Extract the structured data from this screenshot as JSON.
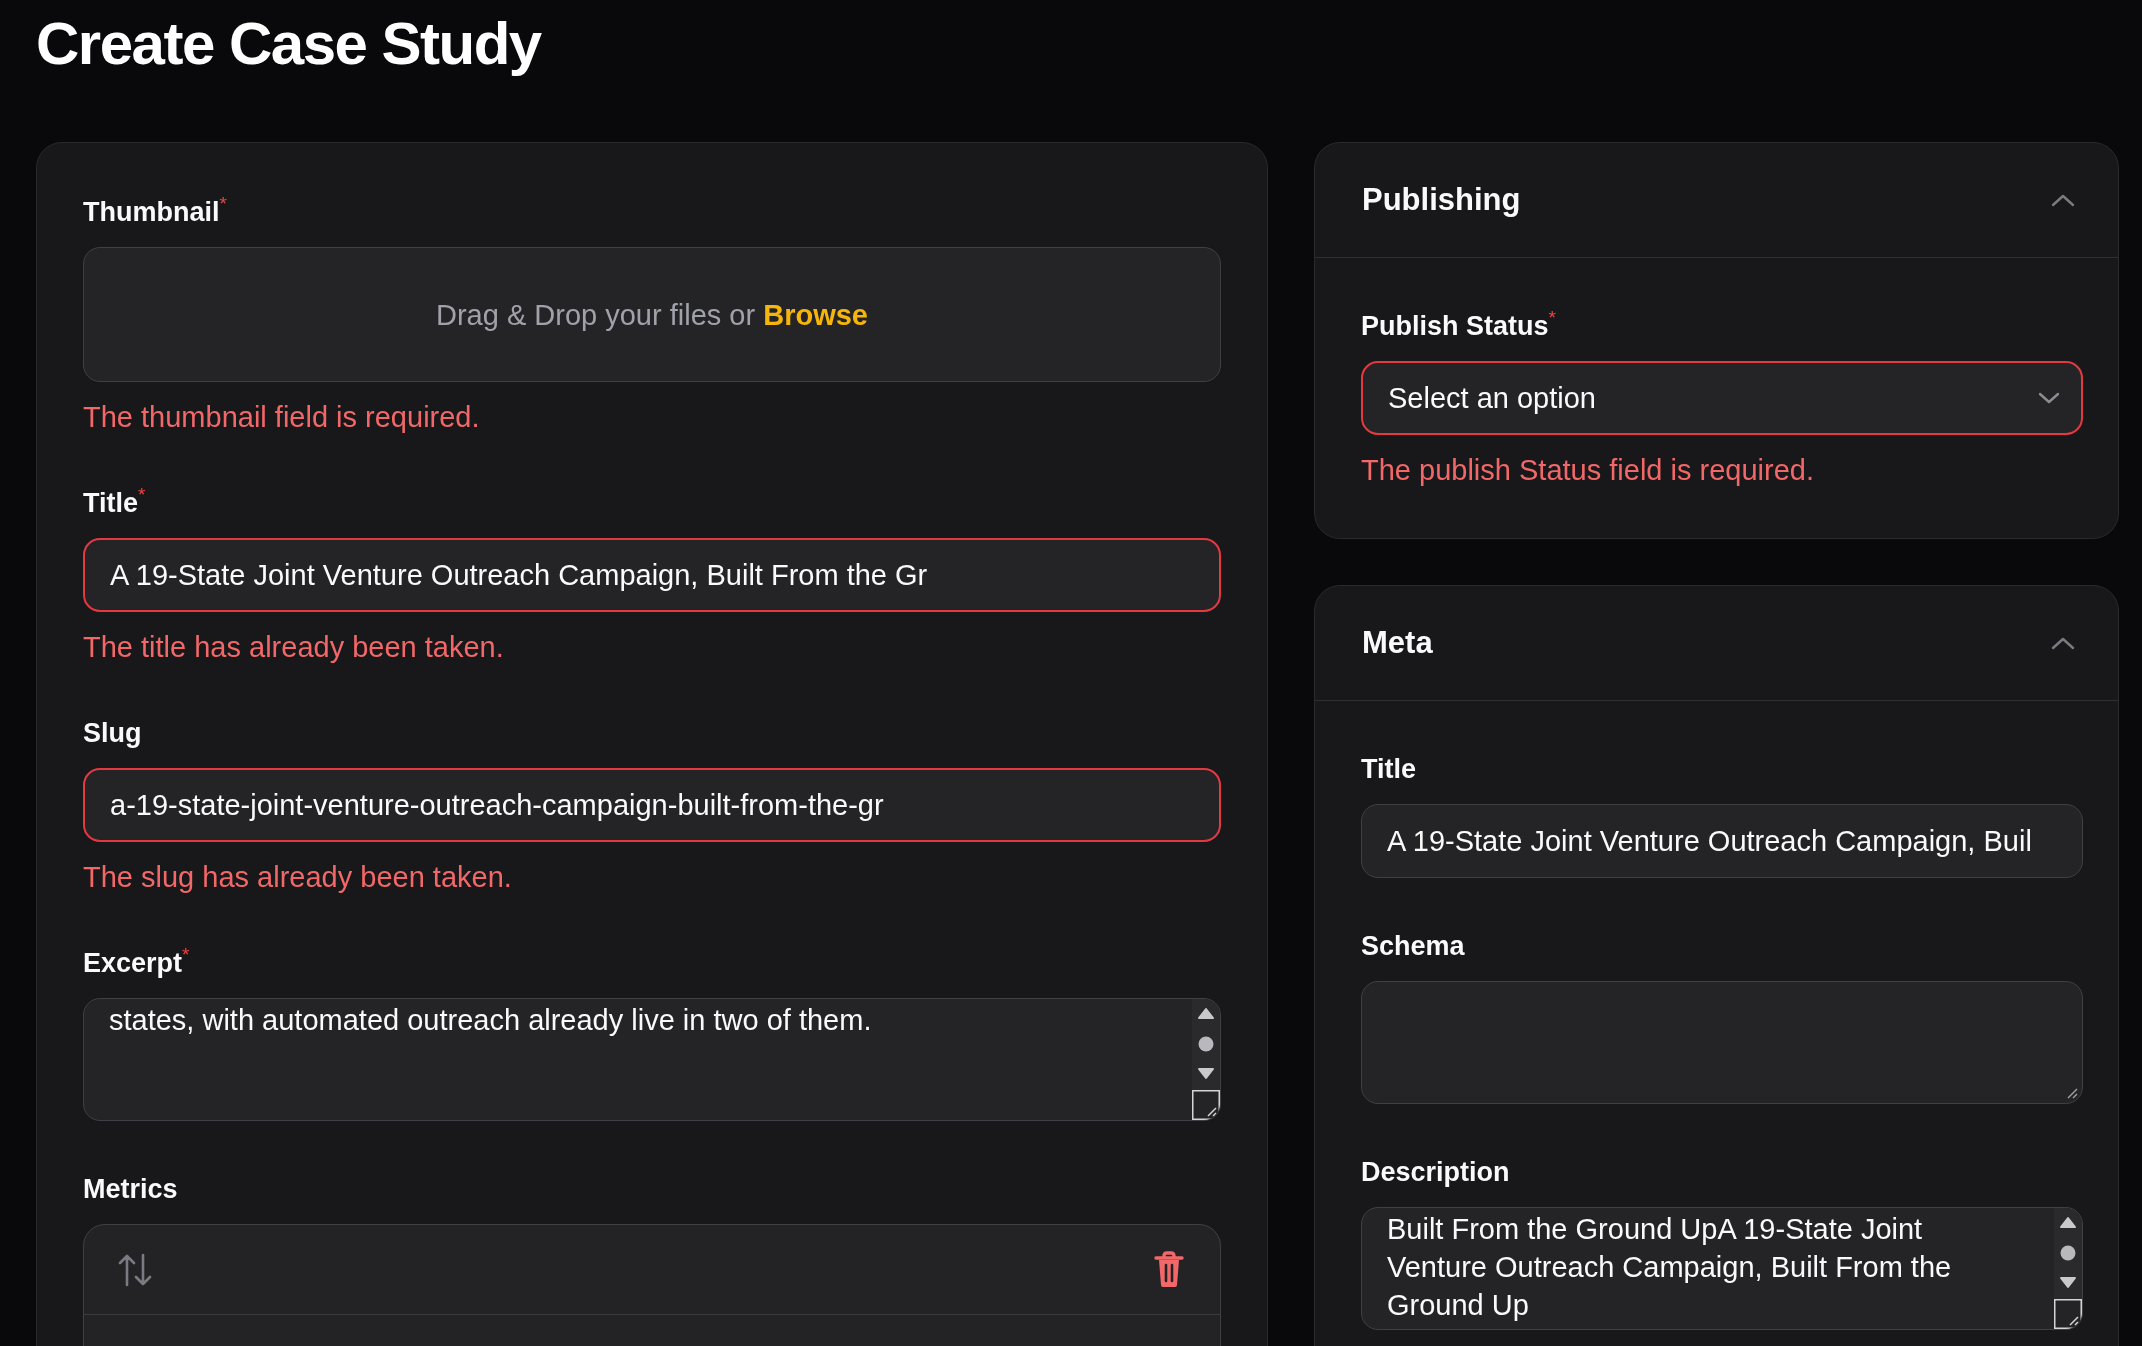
{
  "page_title": "Create Case Study",
  "form": {
    "fields": [
      {
        "kind": "dropzone",
        "label": "Thumbnail$^{*}$",
        "prompt": "Drag & Drop your files or",
        "link": "Browse",
        "error": "The thumbnail field is required."
      },
      {
        "kind": "text",
        "label": "Title$^{*}$",
        "value": "A 19-State Joint Venture Outreach Campaign, Built From the Gr",
        "invalid": true,
        "error": "The title has already been taken."
      },
      {
        "kind": "text",
        "label": "Slug",
        "value": "a-19-state-joint-venture-outreach-campaign-built-from-the-gr",
        "invalid": true,
        "error": "The slug has already been taken."
      },
      {
        "kind": "textarea",
        "label": "Excerpt$^{*}$",
        "value": "states, with automated outreach already live in two of them.",
        "invalid": false,
        "scrollbar": true
      },
      {
        "kind": "repeater",
        "label": "Metrics"
      }
    ]
  },
  "sidebar": {
    "sections": [
      {
        "title": "Publishing",
        "expanded": true,
        "fields": [
          {
            "kind": "select",
            "label": "Publish Status$^{*}$",
            "placeholder": "Select an option",
            "invalid": true,
            "error": "The publish Status field is required."
          }
        ]
      },
      {
        "title": "Meta",
        "expanded": true,
        "fields": [
          {
            "kind": "text",
            "label": "Title",
            "value": "A 19-State Joint Venture Outreach Campaign, Buil",
            "invalid": false
          },
          {
            "kind": "textarea",
            "label": "Schema",
            "invalid": false,
            "scrollbar": false
          },
          {
            "kind": "textarea",
            "label": "Description",
            "value": "Built From the Ground UpA 19-State Joint Venture Outreach Campaign, Built From the Ground Up",
            "invalid": false,
            "scrollbar": true
          }
        ]
      }
    ]
  }
}
